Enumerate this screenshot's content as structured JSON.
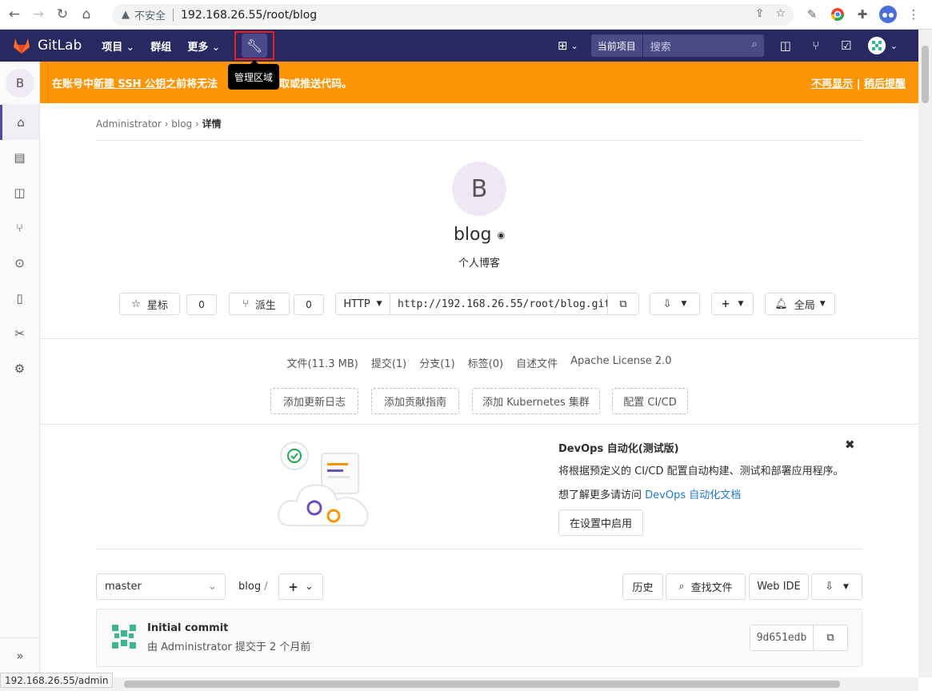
{
  "browser": {
    "insecure_label": "不安全",
    "url": "192.168.26.55/root/blog"
  },
  "topbar": {
    "brand": "GitLab",
    "nav": [
      "项目",
      "群组",
      "更多"
    ],
    "admin_tooltip": "管理区域",
    "search_scope": "当前项目",
    "search_placeholder": "搜索"
  },
  "banner": {
    "text_prefix": "在账号中 ",
    "link": "新建 SSH 公钥",
    "text_suffix": " 之前将无法",
    "text_tail": "拉取或推送代码。",
    "dismiss": "不再显示",
    "divider": " | ",
    "remind": "稍后提醒"
  },
  "sidebar": {
    "project_initial": "B"
  },
  "breadcrumb": {
    "owner": "Administrator",
    "project": "blog",
    "current": "详情"
  },
  "project": {
    "initial": "B",
    "name": "blog",
    "description": "个人博客",
    "star_label": "星标",
    "star_count": "0",
    "fork_label": "派生",
    "fork_count": "0",
    "protocol": "HTTP",
    "clone_url": "http://192.168.26.55/root/blog.git",
    "notification": "全局"
  },
  "stats": [
    "文件(11.3 MB)",
    "提交(1)",
    "分支(1)",
    "标签(0)",
    "自述文件",
    "Apache License 2.0"
  ],
  "quick_actions": [
    "添加更新日志",
    "添加贡献指南",
    "添加 Kubernetes 集群",
    "配置 CI/CD"
  ],
  "devops": {
    "title": "DevOps 自动化(测试版)",
    "description": "将根据预定义的 CI/CD 配置自动构建、测试和部署应用程序。",
    "learn_prefix": "想了解更多请访问 ",
    "learn_link": "DevOps 自动化文档",
    "enable_button": "在设置中启用"
  },
  "repo": {
    "branch": "master",
    "path": "blog",
    "path_sep": "/",
    "history": "历史",
    "find_file": "查找文件",
    "web_ide": "Web IDE"
  },
  "commit": {
    "title": "Initial commit",
    "meta": "由 Administrator 提交于 2 个月前",
    "sha": "9d651edb"
  },
  "status_url": "192.168.26.55/admin",
  "colors": {
    "topbar": "#292961",
    "banner": "#fc9403",
    "highlight": "#e81d1d"
  }
}
